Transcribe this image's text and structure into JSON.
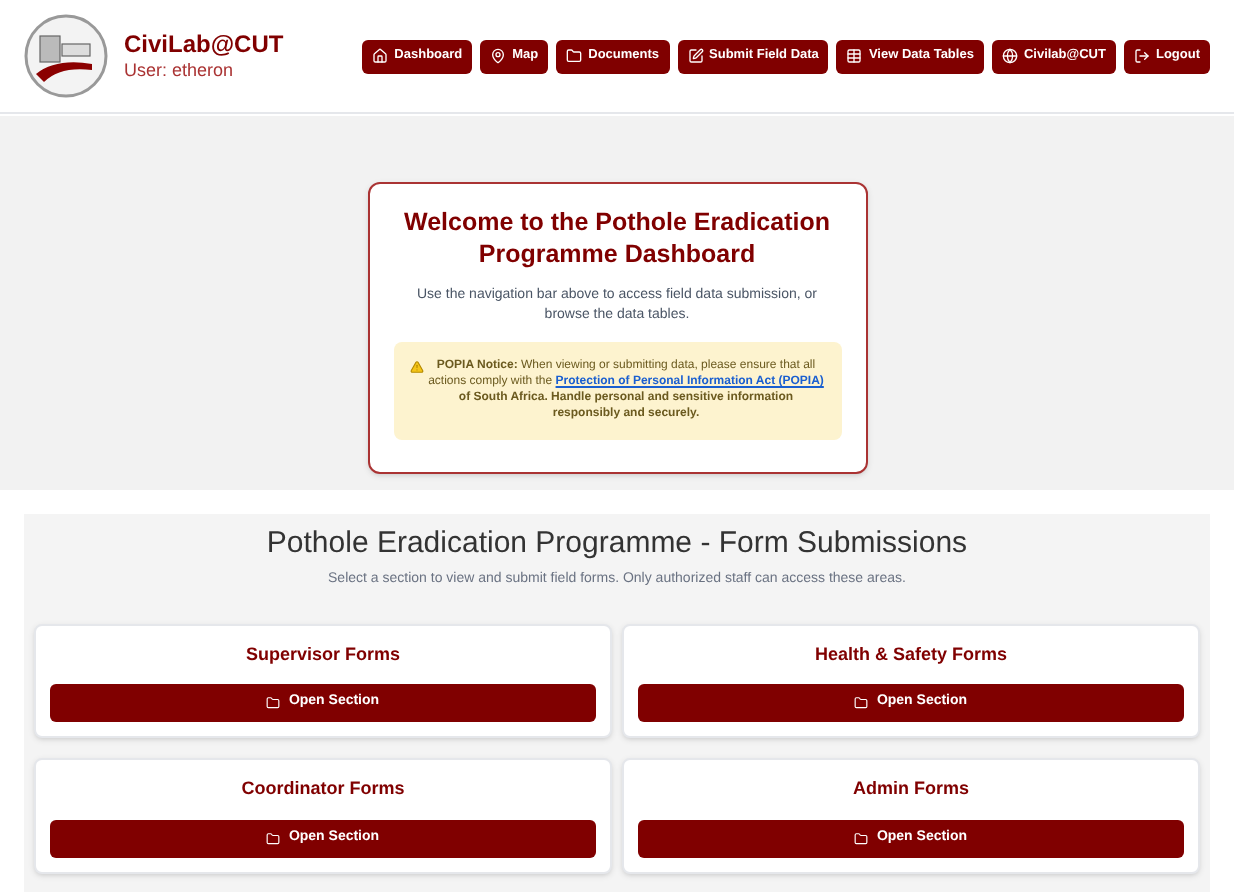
{
  "header": {
    "brand": "CiviLab@CUT",
    "user": "User: etheron"
  },
  "nav": [
    {
      "label": "Dashboard",
      "kind": "home"
    },
    {
      "label": "Map",
      "kind": "pin"
    },
    {
      "label": "Documents",
      "kind": "folder"
    },
    {
      "label": "Submit Field Data",
      "kind": "edit"
    },
    {
      "label": "View Data Tables",
      "kind": "table"
    },
    {
      "label": "Civilab@CUT",
      "kind": "globe"
    },
    {
      "label": "Logout",
      "kind": "logout"
    }
  ],
  "welcome": {
    "title": "Welcome to the Pothole Eradication Programme Dashboard",
    "text": "Use the navigation bar above to access field data submission, or browse the data tables.",
    "notice_before": "**POPIA Notice:** When viewing or submitting data, please ensure that all actions comply with the",
    "notice_link": "Protection of Personal Information Act (POPIA)",
    "notice_after": "of South Africa. Handle personal and sensitive information responsibly and securely."
  },
  "forms": {
    "title": "Pothole Eradication Programme - Form Submissions",
    "subtitle": "Select a section to view and submit field forms. Only authorized staff can access these areas.",
    "sections": [
      {
        "title": "Supervisor Forms",
        "button": "Open Section"
      },
      {
        "title": "Health & Safety Forms",
        "button": "Open Section"
      },
      {
        "title": "Coordinator Forms",
        "button": "Open Section"
      },
      {
        "title": "Admin Forms",
        "button": "Open Section"
      }
    ]
  }
}
